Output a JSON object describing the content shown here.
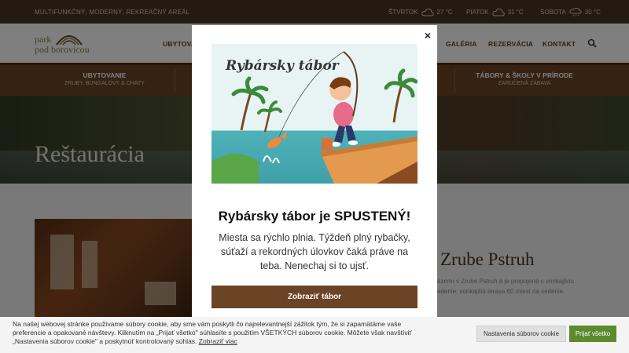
{
  "topbar": {
    "tagline": "MULTIFUNKČNÝ, MODERNÝ, REKREAČNÝ AREÁL",
    "weather": [
      {
        "day": "ŠTVRTOK",
        "temp": "27 °C",
        "icon": "cloud-icon"
      },
      {
        "day": "PIATOK",
        "temp": "31 °C",
        "icon": "cloud-icon"
      },
      {
        "day": "SOBOTA",
        "temp": "30 °C",
        "icon": "rain-cloud-icon"
      }
    ]
  },
  "header": {
    "logo": {
      "line1": "park",
      "line2": "pod borovicou"
    },
    "nav": [
      "UBYTOVA",
      "GALÉRIA",
      "REZERVÁCIA",
      "KONTAKT"
    ],
    "search_icon": "search-icon"
  },
  "categories": [
    {
      "title": "UBYTOVANIE",
      "subtitle": "ZRUBY, BUNGALOVY & CHATY"
    },
    {
      "title": "TÁBORY & ŠKOLY V PRÍRODE",
      "subtitle": "ZARUČENÁ ZÁBAVA"
    }
  ],
  "hero": {
    "title": "Reštaurácia"
  },
  "content": {
    "heading": "Zrube Pstruh",
    "para": "ezemí v Zrube Pstruh a je prepojená s vonkajšou edenie, vonkajšia terasa 60 miest na sedenie."
  },
  "modal": {
    "image_title": "Rybársky tábor",
    "title": "Rybársky tábor je SPUSTENÝ!",
    "text": "Miesta sa rýchlo plnia. Týždeň plný rybačky, súťaží a rekordných úlovkov čaká práve na teba. Nenechaj si to ujsť.",
    "button": "Zobraziť tábor",
    "close": "×"
  },
  "cookie": {
    "text": "Na našej webovej stránke používame súbory cookie, aby sme vám poskytli čo najrelevantnejší zážitok tým, že si zapamätáme vaše preferencie a opakované návštevy. Kliknutím na „Prijať všetko\" súhlasíte s použitím VŠETKÝCH súborov cookie. Môžete však navštíviť „Nastavenia súborov cookie\" a poskytnúť kontrolovaný súhlas.",
    "link": "Zobraziť viac",
    "settings": "Nastavenia súborov cookie",
    "accept": "Prijať všetko"
  },
  "colors": {
    "brown_dark": "#4a3523",
    "brown": "#6b4425",
    "green_accept": "#5e8a2f"
  }
}
